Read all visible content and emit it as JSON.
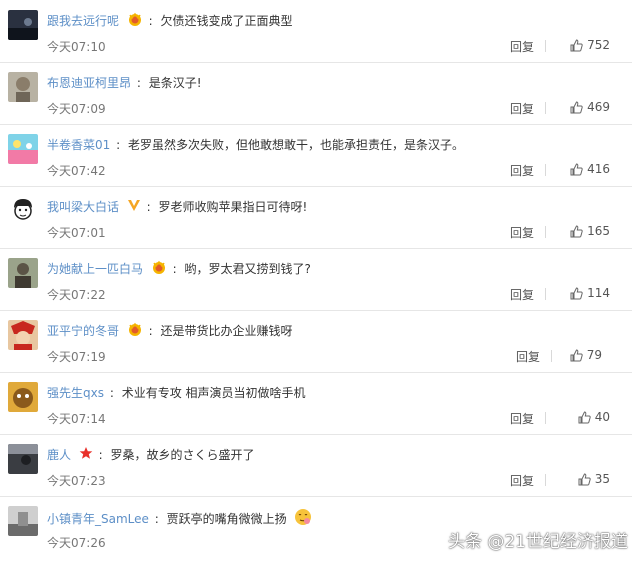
{
  "comments": [
    {
      "user": "跟我去远行呢",
      "badge": "crown-icon",
      "text": "欠债还钱变成了正面典型",
      "time": "今天07:10",
      "reply": "回复",
      "likes": "752"
    },
    {
      "user": "布恩迪亚柯里昂",
      "badge": "",
      "text": "是条汉子!",
      "time": "今天07:09",
      "reply": "回复",
      "likes": "469"
    },
    {
      "user": "半卷香菜01",
      "badge": "",
      "text": "老罗虽然多次失败，但他敢想敢干，也能承担责任，是条汉子。",
      "time": "今天07:42",
      "reply": "回复",
      "likes": "416"
    },
    {
      "user": "我叫梁大白话",
      "badge": "v-icon",
      "text": "罗老师收购苹果指日可待呀!",
      "time": "今天07:01",
      "reply": "回复",
      "likes": "165"
    },
    {
      "user": "为她献上一匹白马",
      "badge": "crown-icon",
      "text": "哟，罗太君又捞到钱了?",
      "time": "今天07:22",
      "reply": "回复",
      "likes": "114"
    },
    {
      "user": "亚平宁的冬哥",
      "badge": "crown-icon",
      "text": "还是带货比办企业赚钱呀",
      "time": "今天07:19",
      "reply": "回复",
      "likes": "79"
    },
    {
      "user": "强先生qxs",
      "badge": "",
      "text": "术业有专攻 相声演员当初做啥手机",
      "time": "今天07:14",
      "reply": "回复",
      "likes": "40"
    },
    {
      "user": "鹿人",
      "badge": "star-icon",
      "text": "罗桑，故乡的さくら盛开了",
      "time": "今天07:23",
      "reply": "回复",
      "likes": "35"
    },
    {
      "user": "小镇青年_SamLee",
      "badge": "",
      "text": "贾跃亭的嘴角微微上扬",
      "time": "今天07:26",
      "reply": "",
      "likes": ""
    }
  ],
  "watermark": "头条 @21世纪经济报道",
  "colors": {
    "username": "#5d8fc7",
    "divider": "#e6e6e6"
  }
}
